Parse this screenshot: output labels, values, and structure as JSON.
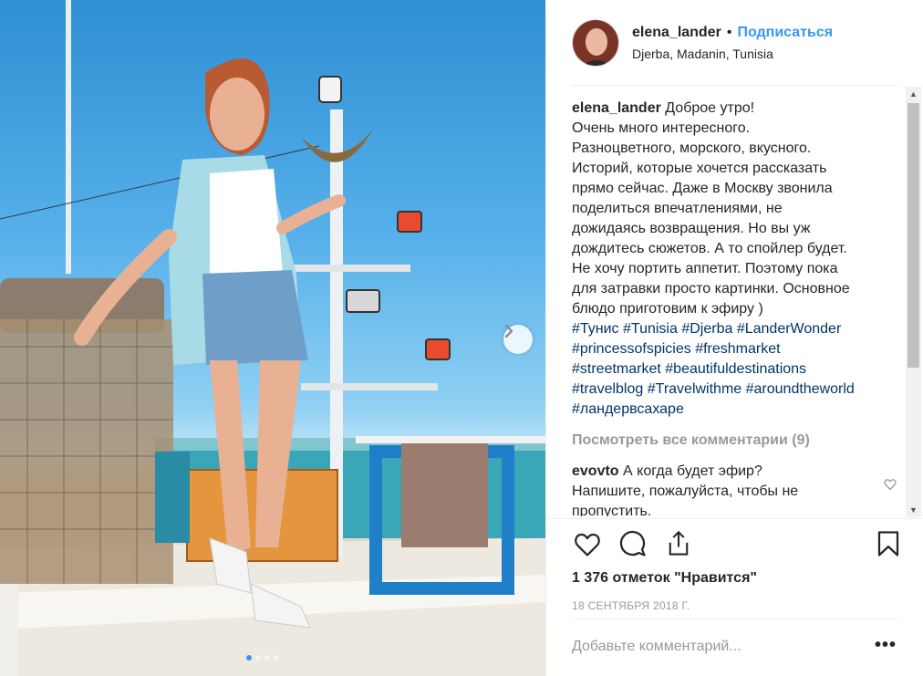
{
  "post": {
    "username": "elena_lander",
    "separator": "•",
    "follow_label": "Подписаться",
    "location": "Djerba, Madanin, Tunisia"
  },
  "caption": {
    "username": "elena_lander",
    "text": " Доброе утро!\nОчень много интересного.\nРазноцветного, морского, вкусного.\nИсторий, которые хочется рассказать\nпрямо сейчас. Даже в Москву звонила\nподелиться впечатлениями, не\nдожидаясь возвращения. Но вы уж\nдождитесь сюжетов. А то спойлер будет.\nНе хочу портить аппетит. Поэтому пока\nдля затравки просто картинки. Основное\nблюдо приготовим к эфиру )",
    "hashtags": [
      "#Тунис",
      "#Tunisia",
      "#Djerba",
      "#LanderWonder",
      "#princessofspicies",
      "#freshmarket",
      "#streetmarket",
      "#beautifuldestinations",
      "#travelblog",
      "#Travelwithme",
      "#aroundtheworld",
      "#ландервсахаре"
    ]
  },
  "view_all_comments": "Посмотреть все комментарии (9)",
  "comments": [
    {
      "username": "evovto",
      "text": " А когда будет эфир?\nНапишите, пожалуйста, чтобы не\nпропустить."
    }
  ],
  "likes_text": "1 376 отметок \"Нравится\"",
  "date_text": "18 СЕНТЯБРЯ 2018 Г.",
  "add_comment_placeholder": "Добавьте комментарий...",
  "more_label": "•••",
  "scroll": {
    "up": "▲",
    "down": "▼"
  },
  "carousel": {
    "slides": 4,
    "active_index": 0
  },
  "icons": {
    "next": "chevron-right-icon",
    "like": "heart-icon",
    "comment": "comment-bubble-icon",
    "share": "share-icon",
    "save": "bookmark-icon",
    "comment_like": "small-heart-icon"
  },
  "colors": {
    "link": "#3897f0",
    "hashtag": "#003569",
    "muted": "#999999",
    "text": "#262626"
  }
}
